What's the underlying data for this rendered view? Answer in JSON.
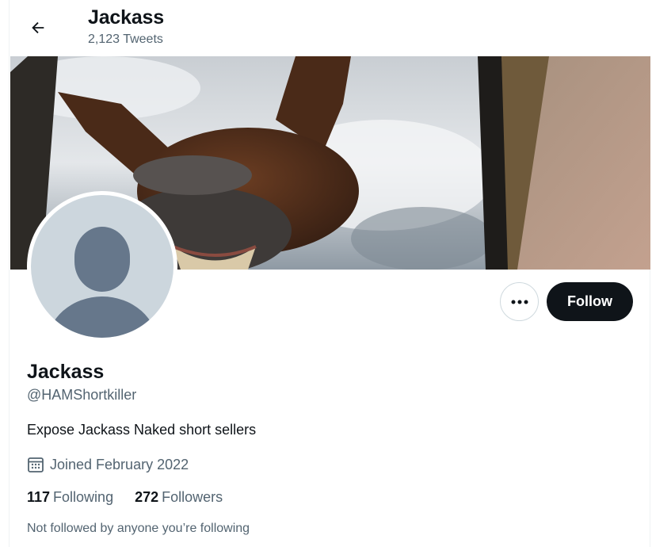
{
  "header": {
    "title": "Jackass",
    "tweet_count": "2,123 Tweets"
  },
  "banner": {
    "description": "donkey-banner"
  },
  "actions": {
    "follow_label": "Follow"
  },
  "profile": {
    "name": "Jackass",
    "handle": "@HAMShortkiller",
    "bio": "Expose Jackass Naked short sellers",
    "joined": "Joined February 2022",
    "following_count": "117",
    "following_label": "Following",
    "followers_count": "272",
    "followers_label": "Followers",
    "not_followed": "Not followed by anyone you’re following"
  },
  "icons": {
    "back": "arrow-left-icon",
    "more": "more-dots-icon",
    "calendar": "calendar-icon"
  },
  "colors": {
    "text_primary": "#0f1419",
    "text_secondary": "#536471",
    "follow_bg": "#0f1419",
    "avatar_bg": "#ccd6dd",
    "avatar_silhouette": "#66778b"
  }
}
